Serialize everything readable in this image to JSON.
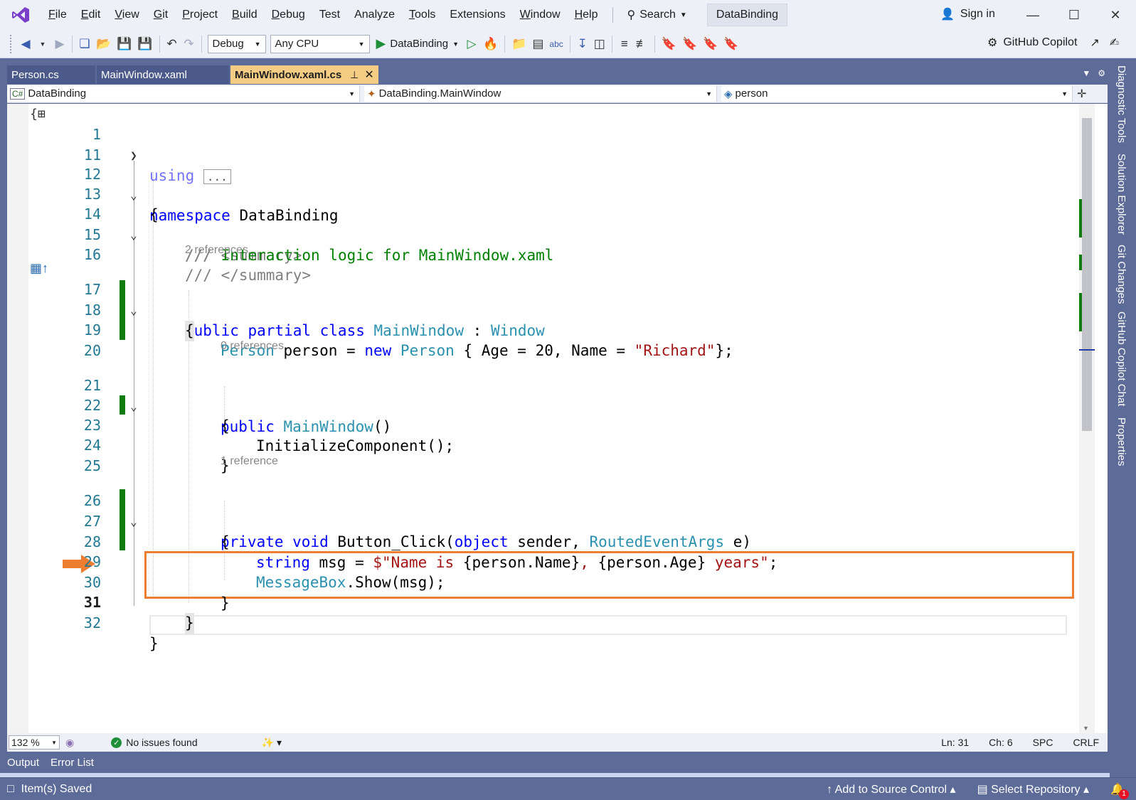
{
  "titlebar": {
    "menu": [
      {
        "label": "File",
        "u": "F",
        "rest": "ile"
      },
      {
        "label": "Edit",
        "u": "E",
        "rest": "dit"
      },
      {
        "label": "View",
        "u": "V",
        "rest": "iew"
      },
      {
        "label": "Git",
        "u": "G",
        "rest": "it"
      },
      {
        "label": "Project",
        "u": "P",
        "rest": "roject"
      },
      {
        "label": "Build",
        "u": "B",
        "rest": "uild"
      },
      {
        "label": "Debug",
        "u": "D",
        "rest": "ebug"
      },
      {
        "label": "Test",
        "u": "",
        "rest": "Test"
      },
      {
        "label": "Analyze",
        "u": "",
        "rest": "Analyze"
      },
      {
        "label": "Tools",
        "u": "T",
        "rest": "ools"
      },
      {
        "label": "Extensions",
        "u": "",
        "rest": "Extensions"
      },
      {
        "label": "Window",
        "u": "W",
        "rest": "indow"
      },
      {
        "label": "Help",
        "u": "H",
        "rest": "elp"
      }
    ],
    "search_label": "Search",
    "solution_name": "DataBinding",
    "signin_label": "Sign in"
  },
  "toolbar": {
    "config": "Debug",
    "platform": "Any CPU",
    "run_target": "DataBinding",
    "copilot_label": "GitHub Copilot"
  },
  "tabs": [
    {
      "label": "Person.cs",
      "active": false
    },
    {
      "label": "MainWindow.xaml",
      "active": false
    },
    {
      "label": "MainWindow.xaml.cs",
      "active": true
    }
  ],
  "navbar": {
    "project": "DataBinding",
    "type": "DataBinding.MainWindow",
    "member": "person"
  },
  "code": {
    "line_numbers": [
      "1",
      "11",
      "12",
      "13",
      "14",
      "15",
      "16",
      "17",
      "18",
      "19",
      "20",
      "21",
      "22",
      "23",
      "24",
      "25",
      "26",
      "27",
      "28",
      "29",
      "30",
      "31",
      "32"
    ],
    "current_line": "31",
    "codelens": [
      "2 references",
      "0 references",
      "1 reference"
    ],
    "lines": {
      "using_kw": "using",
      "using_collapsed": "...",
      "namespace_kw": "namespace",
      "namespace_name": "DataBinding",
      "open_brace": "{",
      "close_brace": "}",
      "summary_open": "/// <summary>",
      "summary_prefix": "///",
      "summary_text": "Interaction logic for MainWindow.xaml",
      "summary_close": "/// </summary>",
      "class_mods": "public partial class",
      "class_name": "MainWindow",
      "class_colon": ":",
      "class_base": "Window",
      "field_type": "Person",
      "field_mid": "person =",
      "field_new": "new",
      "field_type2": "Person",
      "field_init": "{ Age = 20, Name =",
      "field_str": "\"Richard\"",
      "field_end": "};",
      "ctor_kw": "public",
      "ctor_name": "MainWindow",
      "ctor_parens": "()",
      "init_call": "InitializeComponent();",
      "method_mods": "private void",
      "method_name": "Button_Click(",
      "param_kw": "object",
      "param_mid": "sender,",
      "param_type": "RoutedEventArgs",
      "param_end": "e)",
      "msg_kw": "string",
      "msg_mid": "msg =",
      "msg_str1": "$\"Name is ",
      "msg_interp1": "{person.Name}",
      "msg_str2": ", ",
      "msg_interp2": "{person.Age}",
      "msg_str3": " years\"",
      "msg_end": ";",
      "show_type": "MessageBox",
      "show_call": ".Show(msg);"
    }
  },
  "editor_status": {
    "zoom": "132 %",
    "issues": "No issues found",
    "ln": "Ln: 31",
    "ch": "Ch: 6",
    "spc": "SPC",
    "eol": "CRLF"
  },
  "tool_tabs": [
    "Output",
    "Error List"
  ],
  "statusbar": {
    "saved": "Item(s) Saved",
    "source_control": "Add to Source Control",
    "repository": "Select Repository",
    "notifications": "1"
  },
  "side_strip": [
    "Diagnostic Tools",
    "Solution Explorer",
    "Git Changes",
    "GitHub Copilot Chat",
    "Properties"
  ],
  "colors": {
    "keyword": "#0000ff",
    "type": "#2b91af",
    "string": "#a31515",
    "comment": "#008000",
    "highlight_box": "#ed7d31",
    "change_bar": "#107c10",
    "active_tab": "#f5cc84",
    "chrome": "#5d6b99"
  }
}
